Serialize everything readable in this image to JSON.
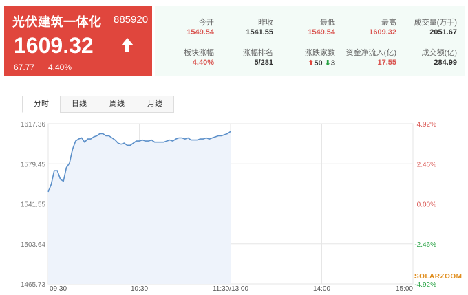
{
  "header": {
    "name": "光伏建筑一体化",
    "code": "885920",
    "price": "1609.32",
    "change": "67.77",
    "change_pct": "4.40%",
    "stats": [
      {
        "label": "今开",
        "value": "1549.54",
        "color": "red"
      },
      {
        "label": "昨收",
        "value": "1541.55",
        "color": "normal"
      },
      {
        "label": "最低",
        "value": "1549.54",
        "color": "red"
      },
      {
        "label": "最高",
        "value": "1609.32",
        "color": "red"
      },
      {
        "label": "成交量(万手)",
        "value": "2051.67",
        "color": "normal"
      },
      {
        "label": "板块涨幅",
        "value": "4.40%",
        "color": "red"
      },
      {
        "label": "涨幅排名",
        "value": "5/281",
        "color": "normal"
      },
      {
        "label": "涨跌家数",
        "up": "50",
        "down": "3"
      },
      {
        "label": "资金净流入(亿)",
        "value": "17.55",
        "color": "red"
      },
      {
        "label": "成交额(亿)",
        "value": "284.99",
        "color": "normal"
      }
    ]
  },
  "tabs": [
    "分时",
    "日线",
    "周线",
    "月线"
  ],
  "active_tab": "分时",
  "watermark": "SOLARZOOM",
  "chart_data": {
    "type": "line",
    "x_ticks": [
      "09:30",
      "10:30",
      "11:30/13:00",
      "14:00",
      "15:00"
    ],
    "y_left_ticks": [
      "1617.36",
      "1579.45",
      "1541.55",
      "1503.64",
      "1465.73"
    ],
    "y_right_ticks": [
      "4.92%",
      "2.46%",
      "0.00%",
      "-2.46%",
      "-4.92%"
    ],
    "ylim": [
      1465.73,
      1617.36
    ],
    "x_range_minutes": [
      0,
      240
    ],
    "series": [
      {
        "x": [
          0,
          2,
          4,
          6,
          8,
          10,
          12,
          14,
          16,
          18,
          20,
          22,
          24,
          26,
          28,
          30,
          32,
          34,
          36,
          38,
          40,
          42,
          44,
          46,
          48,
          50,
          52,
          54,
          56,
          58,
          60,
          62,
          64,
          66,
          68,
          70,
          72,
          74,
          76,
          78,
          80,
          82,
          84,
          86,
          88,
          90,
          92,
          94,
          96,
          98,
          100,
          102,
          104,
          106,
          108,
          110,
          112,
          114,
          116,
          118,
          120
        ],
        "values": [
          1553,
          1560,
          1573,
          1573,
          1565,
          1563,
          1576,
          1580,
          1593,
          1601,
          1603,
          1604,
          1600,
          1603,
          1603,
          1605,
          1606,
          1608,
          1608,
          1606,
          1606,
          1604,
          1602,
          1599,
          1598,
          1599,
          1597,
          1597,
          1599,
          1601,
          1601,
          1602,
          1601,
          1601,
          1602,
          1600,
          1600,
          1600,
          1600,
          1601,
          1602,
          1601,
          1603,
          1604,
          1604,
          1603,
          1604,
          1602,
          1602,
          1602,
          1603,
          1603,
          1604,
          1603,
          1604,
          1605,
          1606,
          1606,
          1607,
          1608,
          1610
        ]
      }
    ],
    "prev_close": 1541.55,
    "grid": true
  }
}
